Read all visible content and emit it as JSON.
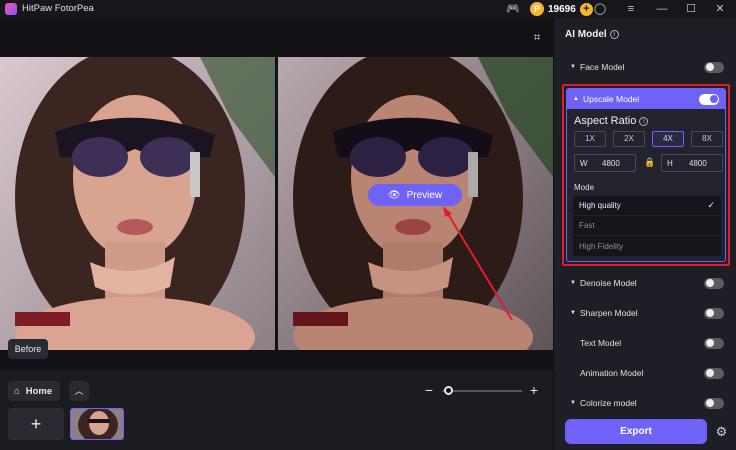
{
  "app": {
    "title": "HitPaw FotorPea"
  },
  "titlebar": {
    "coins": "19696",
    "coin_symbol": "P",
    "plus": "+",
    "icons": [
      "discord-icon",
      "user-icon",
      "menu-icon",
      "minimize-icon",
      "maximize-icon",
      "close-icon"
    ],
    "glyphs": {
      "discord": "🎮",
      "user": "◯",
      "menu": "≡",
      "minimize": "—",
      "maximize": "☐",
      "close": "✕"
    }
  },
  "canvas": {
    "before_label": "Before",
    "preview_label": "Preview",
    "crop_glyph": "⌗",
    "eye_glyph": "👁"
  },
  "bottom": {
    "home_label": "Home",
    "home_glyph": "⌂",
    "up_glyph": "︿",
    "zoom_minus": "−",
    "zoom_plus": "+",
    "zoom_level": 0.05,
    "add_glyph": "+"
  },
  "panel": {
    "title": "AI Model",
    "info": "i",
    "models": {
      "face": {
        "label": "Face Model",
        "on": false
      },
      "upscale": {
        "label": "Upscale Model",
        "on": true
      },
      "denoise": {
        "label": "Denoise Model",
        "on": false
      },
      "sharpen": {
        "label": "Sharpen Model",
        "on": false
      },
      "text": {
        "label": "Text Model",
        "on": false
      },
      "animation": {
        "label": "Animation Model",
        "on": false
      },
      "colorize": {
        "label": "Colorize model",
        "on": false
      }
    },
    "caret_down": "▼",
    "caret_up": "▲",
    "upscale": {
      "aspect_label": "Aspect Ratio",
      "scales": [
        "1X",
        "2X",
        "4X",
        "8X"
      ],
      "active_scale": "4X",
      "width_key": "W",
      "width_value": "4800",
      "height_key": "H",
      "height_value": "4800",
      "lock_glyph": "🔒",
      "mode_label": "Mode",
      "modes": [
        "High quality",
        "Fast",
        "High Fidelity"
      ],
      "selected_mode": "High quality",
      "check_glyph": "✓"
    },
    "export_label": "Export",
    "settings_glyph": "⚙"
  },
  "colors": {
    "accent": "#6f62f7",
    "highlight_border": "#e11d2e",
    "coin": "#f4b731",
    "background": "#1b1b22"
  }
}
